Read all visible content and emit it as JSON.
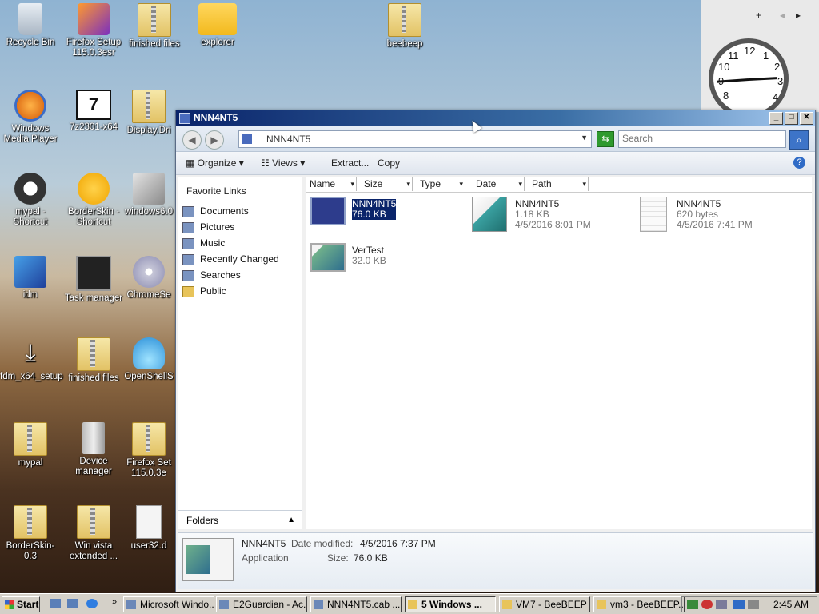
{
  "desktop": {
    "icons": [
      {
        "label": "Recycle Bin"
      },
      {
        "label": "Firefox Setup 115.0.3esr"
      },
      {
        "label": "finished files"
      },
      {
        "label": "explorer"
      },
      {
        "label": "beebeep"
      },
      {
        "label": "Windows Media Player"
      },
      {
        "label": "7z2301-x64"
      },
      {
        "label": "Display.Dri"
      },
      {
        "label": "mypal - Shortcut"
      },
      {
        "label": "BorderSkin - Shortcut"
      },
      {
        "label": "windows6.0"
      },
      {
        "label": "idm"
      },
      {
        "label": "Task manager"
      },
      {
        "label": "ChromeSe"
      },
      {
        "label": "fdm_x64_setup"
      },
      {
        "label": "finished files"
      },
      {
        "label": "OpenShellS"
      },
      {
        "label": "mypal"
      },
      {
        "label": "Device manager"
      },
      {
        "label": "Firefox Set 115.0.3e"
      },
      {
        "label": "BorderSkin-0.3"
      },
      {
        "label": "Win vista extended ..."
      },
      {
        "label": "user32.d"
      }
    ]
  },
  "gadgets": {
    "add": "+",
    "prev": "◂",
    "next": "▸"
  },
  "clock": {
    "n12": "12",
    "n1": "1",
    "n2": "2",
    "n3": "3",
    "n4": "4",
    "n8": "8",
    "n9": "9",
    "n10": "10",
    "n11": "11"
  },
  "window": {
    "title": "NNN4NT5",
    "controls": {
      "minimize": "_",
      "maximize": "□",
      "close": "✕"
    },
    "address": {
      "path": "NNN4NT5",
      "dropdown": "▼"
    },
    "nav": {
      "back": "◀",
      "forward": "▶",
      "go": "⇆"
    },
    "search": {
      "placeholder": "Search",
      "button": "⌕"
    },
    "toolbar": {
      "organize": "Organize",
      "views": "Views",
      "extract": "Extract...",
      "copy": "Copy",
      "help": "?"
    },
    "favorites": {
      "header": "Favorite Links",
      "items": [
        {
          "label": "Documents"
        },
        {
          "label": "Pictures"
        },
        {
          "label": "Music"
        },
        {
          "label": "Recently Changed"
        },
        {
          "label": "Searches"
        },
        {
          "label": "Public"
        }
      ],
      "folders_label": "Folders"
    },
    "columns": [
      "Name",
      "Size",
      "Type",
      "Date",
      "Path"
    ],
    "files": [
      {
        "name": "NNN4NT5",
        "size": "76.0 KB",
        "date": ""
      },
      {
        "name": "NNN4NT5",
        "size": "1.18 KB",
        "date": "4/5/2016 8:01 PM"
      },
      {
        "name": "NNN4NT5",
        "size": "620 bytes",
        "date": "4/5/2016 7:41 PM"
      },
      {
        "name": "VerTest",
        "size": "32.0 KB",
        "date": ""
      }
    ],
    "details": {
      "name": "NNN4NT5",
      "modified_label": "Date modified:",
      "modified": "4/5/2016 7:37 PM",
      "type": "Application",
      "size_label": "Size:",
      "size": "76.0 KB"
    }
  },
  "taskbar": {
    "start": "Start",
    "tasks": [
      {
        "label": "Microsoft Windo..."
      },
      {
        "label": "E2Guardian - Ac..."
      },
      {
        "label": "NNN4NT5.cab ..."
      },
      {
        "label": "5 Windows ..."
      },
      {
        "label": "VM7 - BeeBEEP"
      },
      {
        "label": "vm3 - BeeBEEP..."
      }
    ],
    "time": "2:45 AM"
  }
}
